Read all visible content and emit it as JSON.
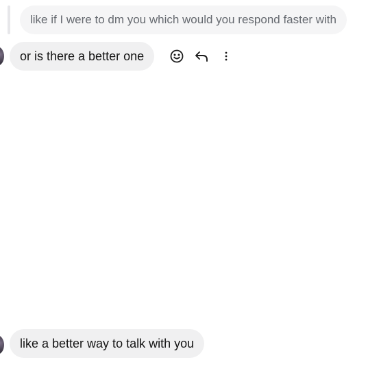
{
  "thread": {
    "quoted_message": "like if I were to dm you which would you respond faster with",
    "messages": [
      {
        "text": "or is there a better one"
      },
      {
        "text": "like a better way to talk with you"
      }
    ]
  },
  "message_actions": {
    "icons": [
      "emoji-reaction-icon",
      "reply-icon",
      "more-options-icon"
    ]
  },
  "colors": {
    "bubble_bg": "#f0f0f1",
    "quoted_bubble_bg": "#f5f5f6",
    "quoted_text": "#666a70",
    "text": "#141414",
    "icon": "#1c1c1c"
  }
}
